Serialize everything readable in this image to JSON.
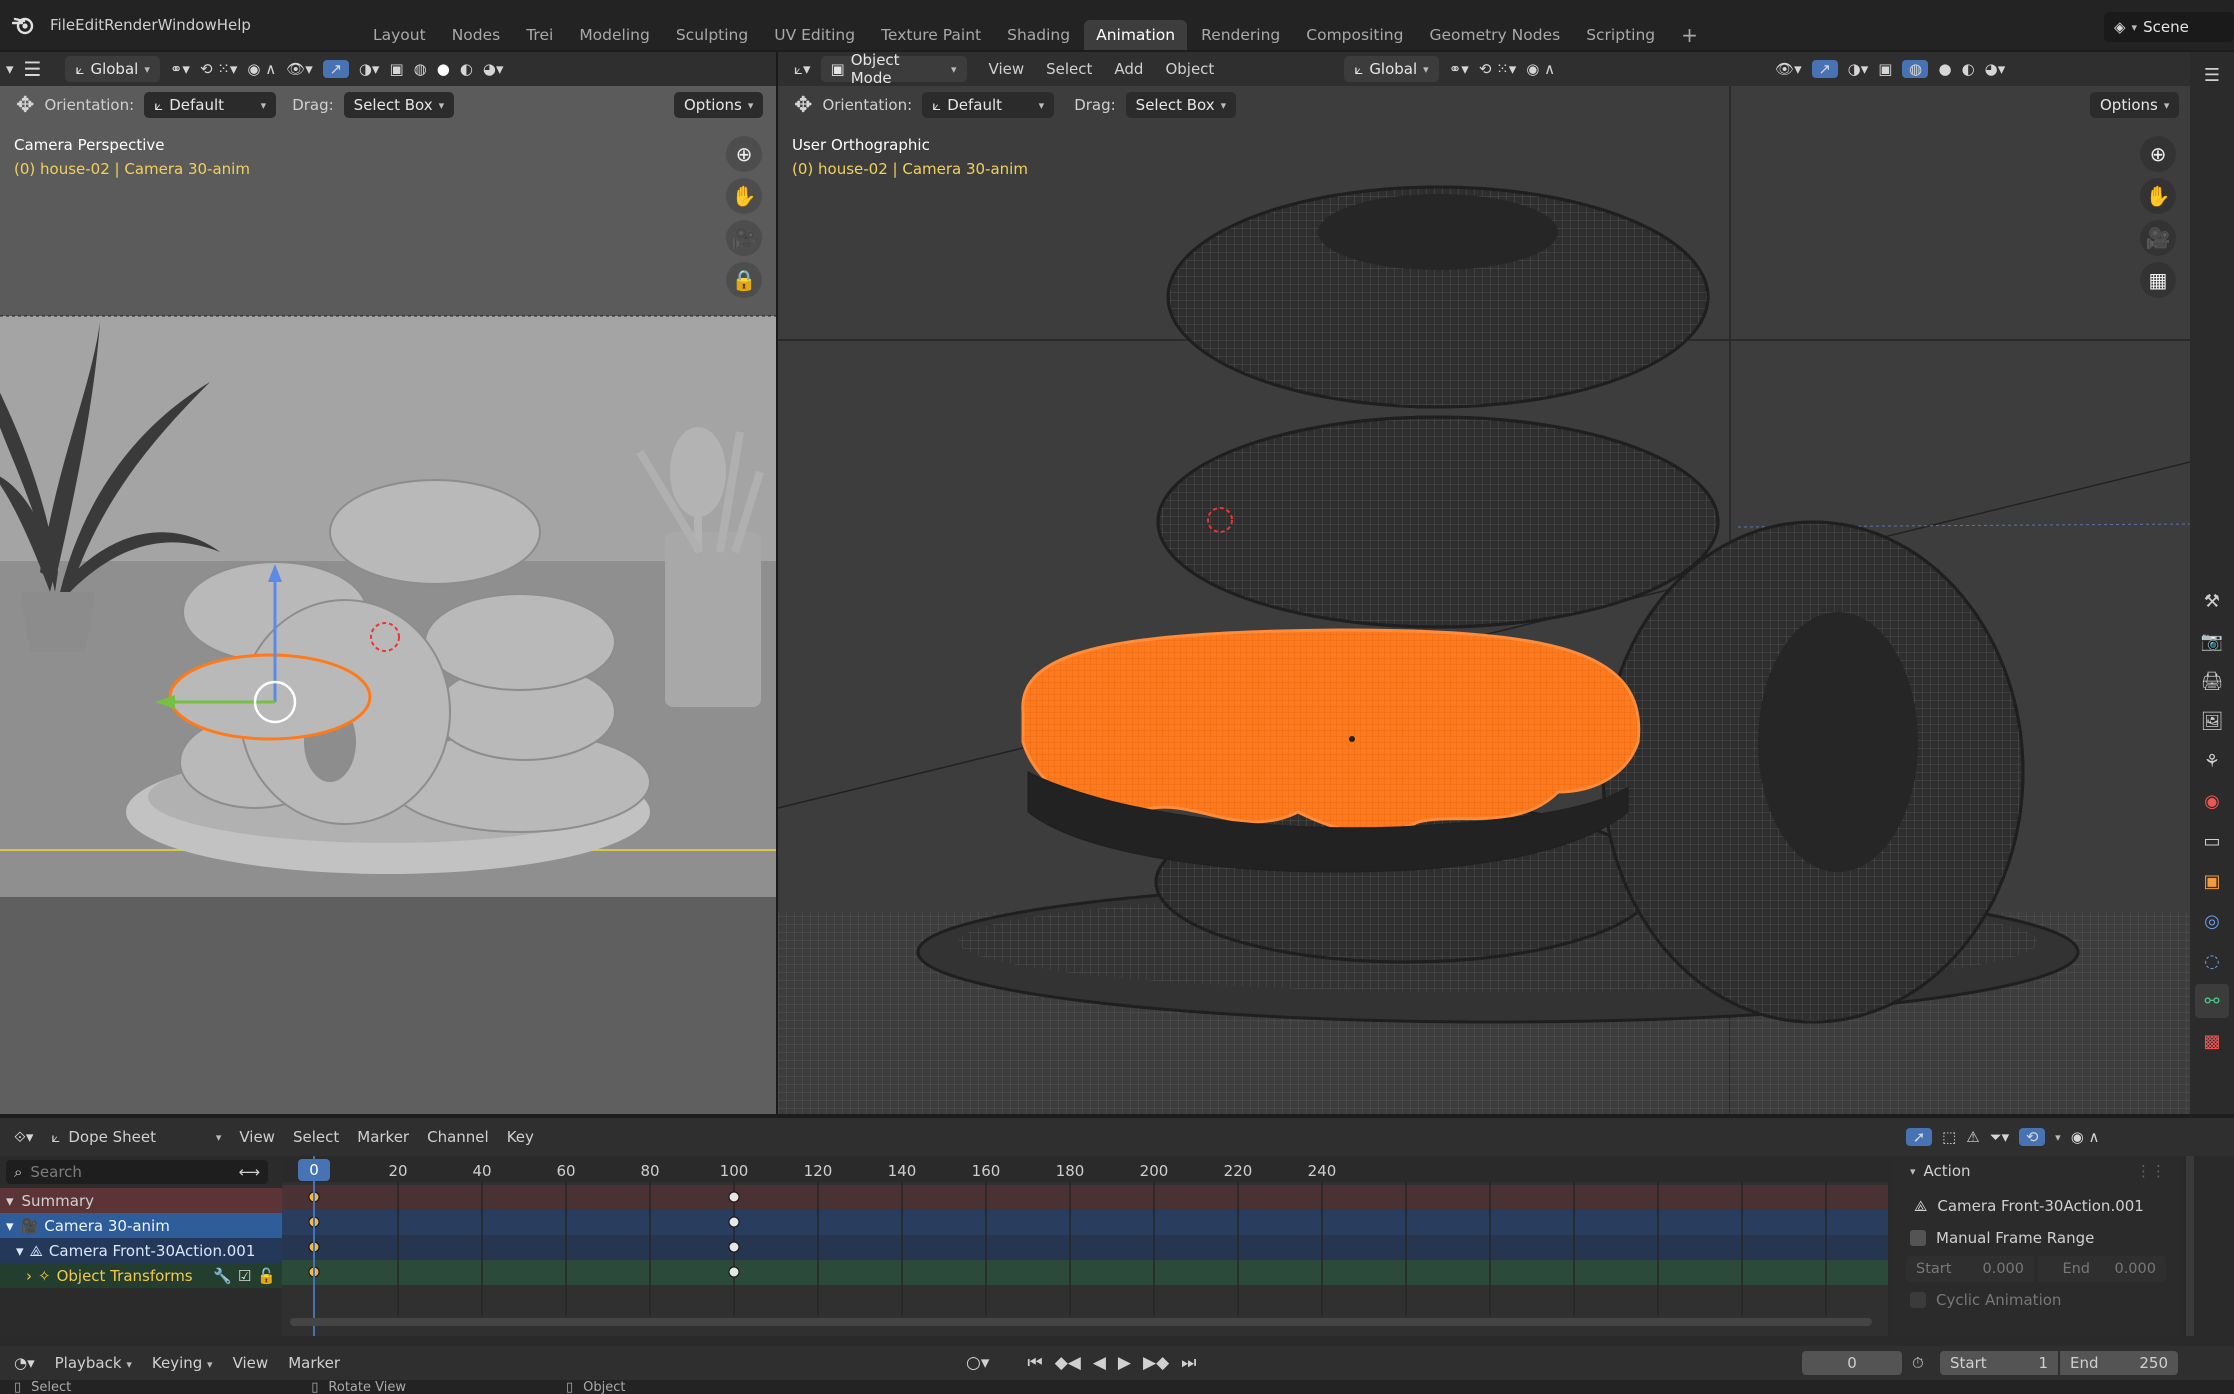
{
  "menubar": {
    "items": [
      "File",
      "Edit",
      "Render",
      "Window",
      "Help"
    ],
    "tabs": [
      "Layout",
      "Nodes",
      "Trei",
      "Modeling",
      "Sculpting",
      "UV Editing",
      "Texture Paint",
      "Shading",
      "Animation",
      "Rendering",
      "Compositing",
      "Geometry Nodes",
      "Scripting"
    ],
    "active_tab": "Animation",
    "add_tab_label": "+",
    "scene_label": "Scene"
  },
  "left_viewport": {
    "orientation_value": "Global",
    "tool_orientation_label": "Orientation:",
    "tool_orientation_value": "Default",
    "drag_label": "Drag:",
    "drag_value": "Select Box",
    "options_label": "Options",
    "view_name": "Camera Perspective",
    "view_sub": "(0) house-02 | Camera 30-anim"
  },
  "right_viewport": {
    "mode_value": "Object Mode",
    "menus": [
      "View",
      "Select",
      "Add",
      "Object"
    ],
    "orientation_value": "Global",
    "tool_orientation_label": "Orientation:",
    "tool_orientation_value": "Default",
    "drag_label": "Drag:",
    "drag_value": "Select Box",
    "options_label": "Options",
    "view_name": "User Orthographic",
    "view_sub": "(0) house-02 | Camera 30-anim"
  },
  "dopesheet": {
    "editor_value": "Dope Sheet",
    "menus": [
      "View",
      "Select",
      "Marker",
      "Channel",
      "Key"
    ],
    "search_placeholder": "Search",
    "current_frame_badge": "0",
    "ticks": [
      "20",
      "40",
      "60",
      "80",
      "100",
      "120",
      "140",
      "160",
      "180",
      "200",
      "220",
      "240"
    ],
    "channels": [
      {
        "label": "Summary"
      },
      {
        "label": "Camera 30-anim"
      },
      {
        "label": "Camera Front-30Action.001"
      },
      {
        "label": "Object Transforms"
      }
    ],
    "keyframes": [
      0,
      100
    ]
  },
  "action_panel": {
    "header": "Action",
    "action_name": "Camera Front-30Action.001",
    "manual_range_label": "Manual Frame Range",
    "start_label": "Start",
    "start_value": "0.000",
    "end_label": "End",
    "end_value": "0.000",
    "cyclic_label": "Cyclic Animation"
  },
  "playback_bar": {
    "playback_label": "Playback",
    "keying_label": "Keying",
    "view_label": "View",
    "marker_label": "Marker",
    "frame_value": "0",
    "start_label": "Start",
    "start_value": "1",
    "end_label": "End",
    "end_value": "250"
  },
  "statusbar": {
    "hints": [
      "Select",
      "Rotate View",
      "Object"
    ]
  },
  "colors": {
    "accent": "#4772b3",
    "selection": "#ff7a1a",
    "header_text_sub": "#f2d15a"
  }
}
